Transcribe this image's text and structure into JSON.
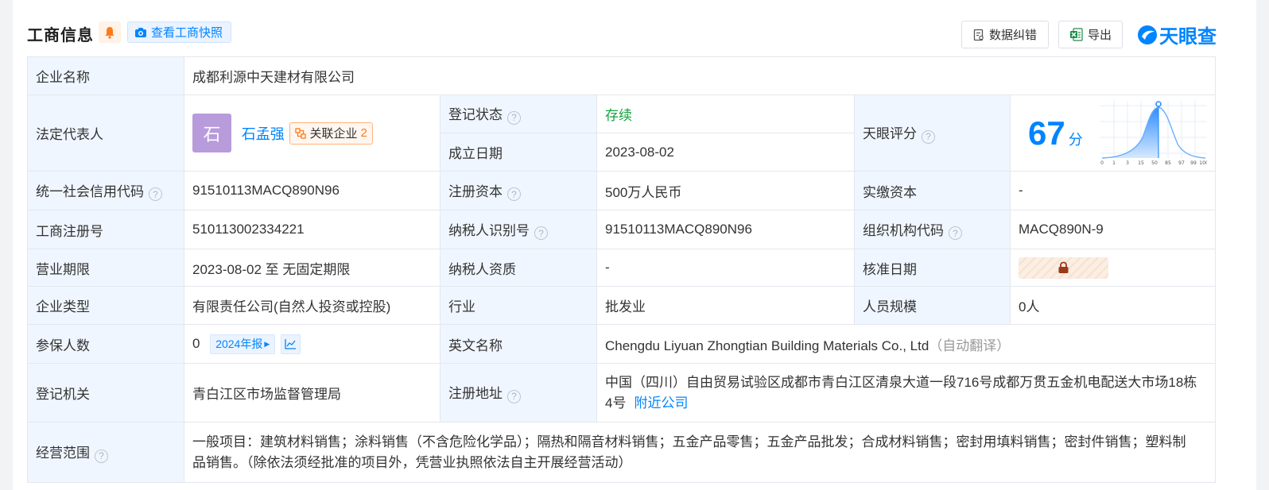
{
  "header": {
    "title": "工商信息",
    "snapshot_label": "查看工商快照",
    "correction_label": "数据纠错",
    "export_label": "导出",
    "logo_text": "天眼查"
  },
  "rows": {
    "company_name": {
      "label": "企业名称",
      "value": "成都利源中天建材有限公司"
    },
    "legal_rep": {
      "label": "法定代表人",
      "avatar_char": "石",
      "name": "石孟强",
      "related_label": "关联企业",
      "related_count": "2"
    },
    "reg_status": {
      "label": "登记状态",
      "value": "存续"
    },
    "established": {
      "label": "成立日期",
      "value": "2023-08-02"
    },
    "tianyan_score": {
      "label": "天眼评分",
      "score": "67",
      "unit": "分",
      "axis_ticks": [
        "0",
        "1",
        "3",
        "15",
        "50",
        "85",
        "97",
        "99",
        "100"
      ]
    },
    "credit_code": {
      "label": "统一社会信用代码",
      "value": "91510113MACQ890N96"
    },
    "reg_capital": {
      "label": "注册资本",
      "value": "500万人民币"
    },
    "paid_capital": {
      "label": "实缴资本",
      "value": "-"
    },
    "reg_number": {
      "label": "工商注册号",
      "value": "510113002334221"
    },
    "taxpayer_id": {
      "label": "纳税人识别号",
      "value": "91510113MACQ890N96"
    },
    "org_code": {
      "label": "组织机构代码",
      "value": "MACQ890N-9"
    },
    "business_term": {
      "label": "营业期限",
      "value": "2023-08-02 至 无固定期限"
    },
    "taxpayer_qual": {
      "label": "纳税人资质",
      "value": "-"
    },
    "approval_date": {
      "label": "核准日期"
    },
    "company_type": {
      "label": "企业类型",
      "value": "有限责任公司(自然人投资或控股)"
    },
    "industry": {
      "label": "行业",
      "value": "批发业"
    },
    "staff_size": {
      "label": "人员规模",
      "value": "0人"
    },
    "insured": {
      "label": "参保人数",
      "value": "0",
      "report_tag": "2024年报"
    },
    "english_name": {
      "label": "英文名称",
      "value": "Chengdu Liyuan Zhongtian Building Materials Co., Ltd",
      "note": "（自动翻译）"
    },
    "reg_authority": {
      "label": "登记机关",
      "value": "青白江区市场监督管理局"
    },
    "reg_address": {
      "label": "注册地址",
      "line1": "中国（四川）自由贸易试验区成都市青白江区清泉大道一段716号成都万贯五金机电配送大市场18栋",
      "line2": "4号",
      "nearby": "附近公司"
    },
    "scope": {
      "label": "经营范围",
      "line1": "一般项目：建筑材料销售；涂料销售（不含危险化学品）；隔热和隔音材料销售；五金产品零售；五金产品批发；合成材料销售；密封用填料销售；密封件销售；塑料制",
      "line2": "品销售。（除依法须经批准的项目外，凭营业执照依法自主开展经营活动）"
    }
  },
  "colors": {
    "accent": "#0084ff",
    "label_bg": "#f0f6ff",
    "status_green": "#12a33c"
  }
}
